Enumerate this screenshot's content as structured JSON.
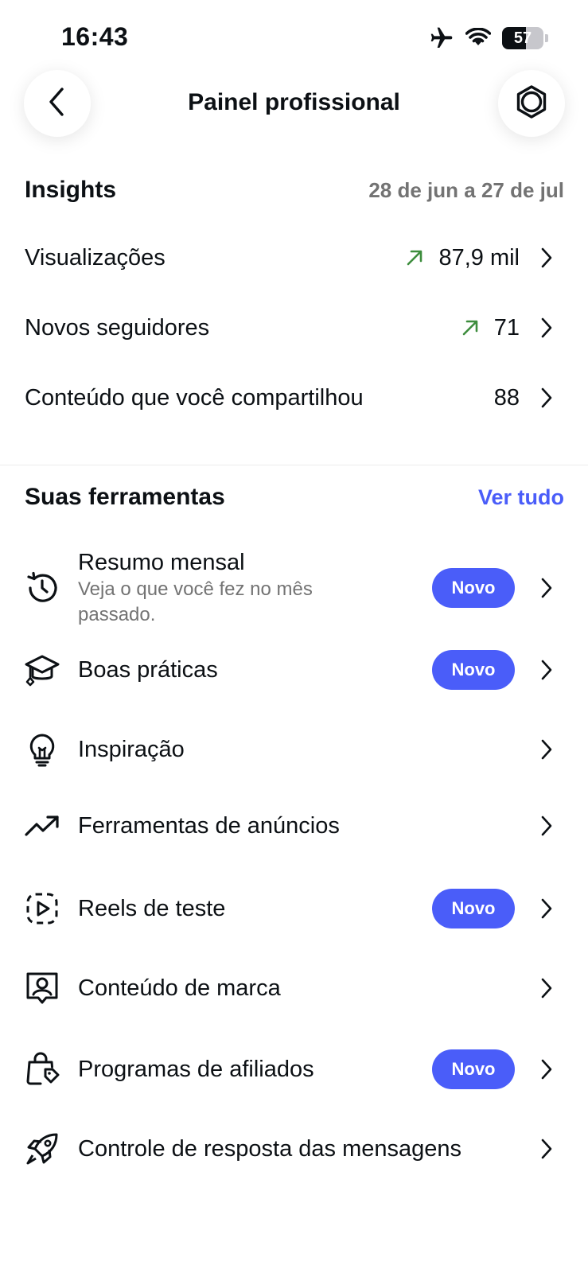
{
  "status_bar": {
    "time": "16:43",
    "battery_level": "57",
    "icons": [
      "airplane-icon",
      "wifi-icon",
      "battery-icon"
    ]
  },
  "header": {
    "title": "Painel profissional",
    "back_icon": "chevron-left-icon",
    "settings_icon": "gear-icon"
  },
  "insights": {
    "title": "Insights",
    "date_range": "28 de jun a 27 de jul",
    "rows": [
      {
        "label": "Visualizações",
        "value": "87,9 mil",
        "trend": "up"
      },
      {
        "label": "Novos seguidores",
        "value": "71",
        "trend": "up"
      },
      {
        "label": "Conteúdo que você compartilhou",
        "value": "88",
        "trend": "none"
      }
    ]
  },
  "tools": {
    "title": "Suas ferramentas",
    "see_all": "Ver tudo",
    "badge_label": "Novo",
    "items": [
      {
        "label": "Resumo mensal",
        "subtitle": "Veja o que você fez no mês passado.",
        "icon": "history-icon",
        "badge": true
      },
      {
        "label": "Boas práticas",
        "icon": "graduation-cap-icon",
        "badge": true
      },
      {
        "label": "Inspiração",
        "icon": "lightbulb-icon",
        "badge": false
      },
      {
        "label": "Ferramentas de anúncios",
        "icon": "trending-up-icon",
        "badge": false
      },
      {
        "label": "Reels de teste",
        "icon": "reels-test-icon",
        "badge": true
      },
      {
        "label": "Conteúdo de marca",
        "icon": "branded-content-icon",
        "badge": false
      },
      {
        "label": "Programas de afiliados",
        "icon": "shopping-bag-tag-icon",
        "badge": true
      },
      {
        "label": "Controle de resposta das mensagens",
        "icon": "rocket-icon",
        "badge": false
      }
    ]
  },
  "colors": {
    "accent": "#4a5df9",
    "trend_up": "#3d8d3d",
    "secondary_text": "#737373",
    "primary_text": "#0c1014"
  }
}
